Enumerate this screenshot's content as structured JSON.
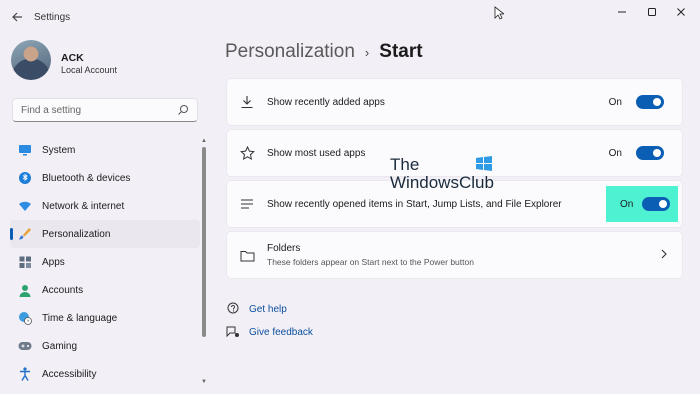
{
  "window": {
    "title": "Settings",
    "controls": [
      "minimize-icon",
      "maximize-icon",
      "close-icon"
    ]
  },
  "profile": {
    "name": "ACK",
    "account_type": "Local Account"
  },
  "search": {
    "placeholder": "Find a setting",
    "icon": "search-icon"
  },
  "sidebar": {
    "items": [
      {
        "label": "System",
        "icon": "monitor-icon",
        "active": false
      },
      {
        "label": "Bluetooth & devices",
        "icon": "bluetooth-icon",
        "active": false
      },
      {
        "label": "Network & internet",
        "icon": "wifi-icon",
        "active": false
      },
      {
        "label": "Personalization",
        "icon": "brush-icon",
        "active": true
      },
      {
        "label": "Apps",
        "icon": "apps-icon",
        "active": false
      },
      {
        "label": "Accounts",
        "icon": "person-icon",
        "active": false
      },
      {
        "label": "Time & language",
        "icon": "globe-clock-icon",
        "active": false
      },
      {
        "label": "Gaming",
        "icon": "gamepad-icon",
        "active": false
      },
      {
        "label": "Accessibility",
        "icon": "accessibility-icon",
        "active": false
      }
    ]
  },
  "breadcrumb": {
    "parent": "Personalization",
    "separator": "›",
    "current": "Start"
  },
  "settings": [
    {
      "label": "Show recently added apps",
      "icon": "download-icon",
      "state": "On",
      "highlighted": false
    },
    {
      "label": "Show most used apps",
      "icon": "star-icon",
      "state": "On",
      "highlighted": false
    },
    {
      "label": "Show recently opened items in Start, Jump Lists, and File Explorer",
      "icon": "list-icon",
      "state": "On",
      "highlighted": true
    }
  ],
  "folders": {
    "title": "Folders",
    "description": "These folders appear on Start next to the Power button",
    "icon": "folder-icon"
  },
  "links": {
    "help": "Get help",
    "feedback": "Give feedback"
  },
  "watermark": {
    "line1": "The",
    "line2": "WindowsClub"
  },
  "colors": {
    "accent": "#0a5fb4",
    "highlight": "#4ef2d3",
    "background": "#f3eff6"
  }
}
